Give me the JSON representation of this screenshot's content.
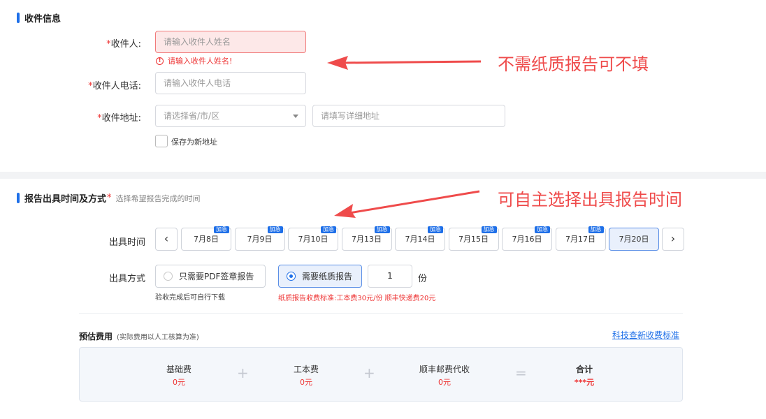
{
  "recipient_section": {
    "title": "收件信息",
    "name_label": "收件人:",
    "name_placeholder": "请输入收件人姓名",
    "name_error": "请输入收件人姓名!",
    "phone_label": "收件人电话:",
    "phone_placeholder": "请输入收件人电话",
    "address_label": "收件地址:",
    "region_placeholder": "请选择省/市/区",
    "detail_placeholder": "请填写详细地址",
    "save_address_label": "保存为新地址",
    "required_mark": "*"
  },
  "annotations": {
    "note1": "不需纸质报告可不填",
    "note2": "可自主选择出具报告时间",
    "arrow_color": "#ef4b4b"
  },
  "report_section": {
    "title": "报告出具时间及方式",
    "required_mark": "*",
    "hint": "选择希望报告完成的时间",
    "time_label": "出具时间",
    "badge_text": "加急",
    "dates": [
      {
        "label": "7月8日",
        "urgent": true,
        "selected": false
      },
      {
        "label": "7月9日",
        "urgent": true,
        "selected": false
      },
      {
        "label": "7月10日",
        "urgent": true,
        "selected": false
      },
      {
        "label": "7月13日",
        "urgent": true,
        "selected": false
      },
      {
        "label": "7月14日",
        "urgent": true,
        "selected": false
      },
      {
        "label": "7月15日",
        "urgent": true,
        "selected": false
      },
      {
        "label": "7月16日",
        "urgent": true,
        "selected": false
      },
      {
        "label": "7月17日",
        "urgent": true,
        "selected": false
      },
      {
        "label": "7月20日",
        "urgent": false,
        "selected": true
      }
    ],
    "prev_icon": "‹",
    "next_icon": "›",
    "method_label": "出具方式",
    "option_pdf": "只需要PDF签章报告",
    "option_pdf_note": "验收完成后可自行下载",
    "option_paper": "需要纸质报告",
    "option_paper_note": "纸质报告收费标准:工本费30元/份  顺丰快递费20元",
    "quantity": "1",
    "quantity_unit": "份"
  },
  "fees": {
    "title": "预估费用",
    "subtitle": "(实际费用以人工核算为准)",
    "standard_link": "科技查新收费标准",
    "items": [
      {
        "name": "基础费",
        "value": "0元"
      },
      {
        "name": "工本费",
        "value": "0元"
      },
      {
        "name": "顺丰邮费代收",
        "value": "0元"
      }
    ],
    "total_label": "合计",
    "total_value": "***元",
    "plus": "+",
    "equals": "="
  },
  "colors": {
    "accent": "#1e6fe8",
    "error": "#e33333",
    "annotation": "#ef4b4b"
  }
}
